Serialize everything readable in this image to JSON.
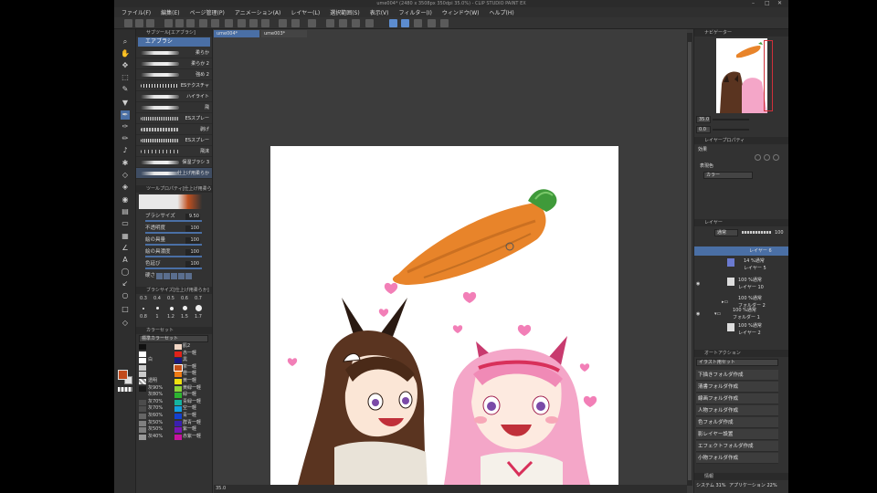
{
  "window": {
    "title": "ume004* (2480 x 3508px 350dpi 35.0%) - CLIP STUDIO PAINT EX"
  },
  "menu": [
    "ファイル(F)",
    "編集(E)",
    "ページ管理(P)",
    "アニメーション(A)",
    "レイヤー(L)",
    "選択範囲(S)",
    "表示(V)",
    "フィルター(I)",
    "ウィンドウ(W)",
    "ヘルプ(H)"
  ],
  "doc_tabs": [
    "ume004*",
    "ume003*"
  ],
  "sub_tool": {
    "title": "サブツール[エアブラシ]",
    "group": "エアブラシ",
    "brushes": [
      "柔らか",
      "柔らか 2",
      "強め 2",
      "ESテクスチャ",
      "ハイライト",
      "飛",
      "ESスプレー",
      "剥げ",
      "ESスプレー",
      "飛沫",
      "保湿ブラシ 3",
      "仕上げ用柔らか"
    ]
  },
  "tool_property": {
    "title": "ツールプロパティ[仕上げ用柔らか]",
    "props": [
      {
        "label": "ブラシサイズ",
        "value": "9.50"
      },
      {
        "label": "不透明度",
        "value": "100"
      },
      {
        "label": "絵の具量",
        "value": "100"
      },
      {
        "label": "絵の具濃度",
        "value": "100"
      },
      {
        "label": "色延び",
        "value": "100"
      },
      {
        "label": "硬さ",
        "value": ""
      }
    ]
  },
  "brush_size": {
    "title": "ブラシサイズ[仕上げ用柔らか]",
    "row1": [
      "0.3",
      "0.4",
      "0.5",
      "0.6",
      "0.7"
    ],
    "row2": [
      "0.8",
      "1",
      "1.2",
      "1.5",
      "1.7"
    ]
  },
  "color_set": {
    "title": "カラーセット",
    "preset": "標準カラーセット",
    "rows": [
      {
        "a": "",
        "b": "肌2",
        "cb": "#f2d6c4"
      },
      {
        "a": "",
        "b": "赤一軽",
        "cb": "#e0221a"
      },
      {
        "a": "白",
        "b": "黒",
        "cb": "#1a1a80"
      },
      {
        "a": "",
        "b": "茶一軽",
        "cb": "#c4501a"
      },
      {
        "a": "",
        "b": "橙一軽",
        "cb": "#ee7a14"
      },
      {
        "a": "透明",
        "b": "黄一軽",
        "cb": "#f0e010"
      },
      {
        "a": "灰90%",
        "b": "黄緑一軽",
        "cb": "#8cd43a"
      },
      {
        "a": "灰80%",
        "b": "緑一軽",
        "cb": "#2cb430"
      },
      {
        "a": "灰70%",
        "b": "青緑一軽",
        "cb": "#14b4a0"
      },
      {
        "a": "灰70%",
        "b": "空一軽",
        "cb": "#14a0e0"
      },
      {
        "a": "灰60%",
        "b": "青一軽",
        "cb": "#1440d0"
      },
      {
        "a": "灰50%",
        "b": "群青一軽",
        "cb": "#3a20b0"
      },
      {
        "a": "灰50%",
        "b": "紫一軽",
        "cb": "#7a14b4"
      },
      {
        "a": "灰40%",
        "b": "赤紫一軽",
        "cb": "#c814a0"
      }
    ]
  },
  "navigator": {
    "title": "ナビゲーター",
    "zoom": "35.0",
    "angle": "0.0"
  },
  "layer_property": {
    "title": "レイヤープロパティ",
    "effect_label": "効果",
    "color_label": "表現色",
    "color_value": "カラー"
  },
  "layers": {
    "title": "レイヤー",
    "blend": "通常",
    "opacity": "100",
    "items": [
      {
        "line1": "",
        "line2": "レイヤー 6"
      },
      {
        "line1": "14 %通常",
        "line2": "レイヤー 5"
      },
      {
        "line1": "100 %通常",
        "line2": "レイヤー 10"
      },
      {
        "line1": "100 %通常",
        "line2": "フォルダー 2"
      },
      {
        "line1": "100 %通常",
        "line2": "フォルダー 1"
      },
      {
        "line1": "100 %通常",
        "line2": "レイヤー 2"
      }
    ]
  },
  "auto_action": {
    "title": "オートアクション",
    "set": "イラスト用セット",
    "items": [
      "下描きフォルダ作成",
      "清書フォルダ作成",
      "線画フォルダ作成",
      "人物フォルダ作成",
      "色フォルダ作成",
      "影レイヤー設置",
      "エフェクトフォルダ作成",
      "小物フォルダ作成"
    ]
  },
  "status": {
    "zoom": "35.0",
    "system": "システム 31%",
    "app": "アプリケーション 22%",
    "info_title": "情報"
  }
}
